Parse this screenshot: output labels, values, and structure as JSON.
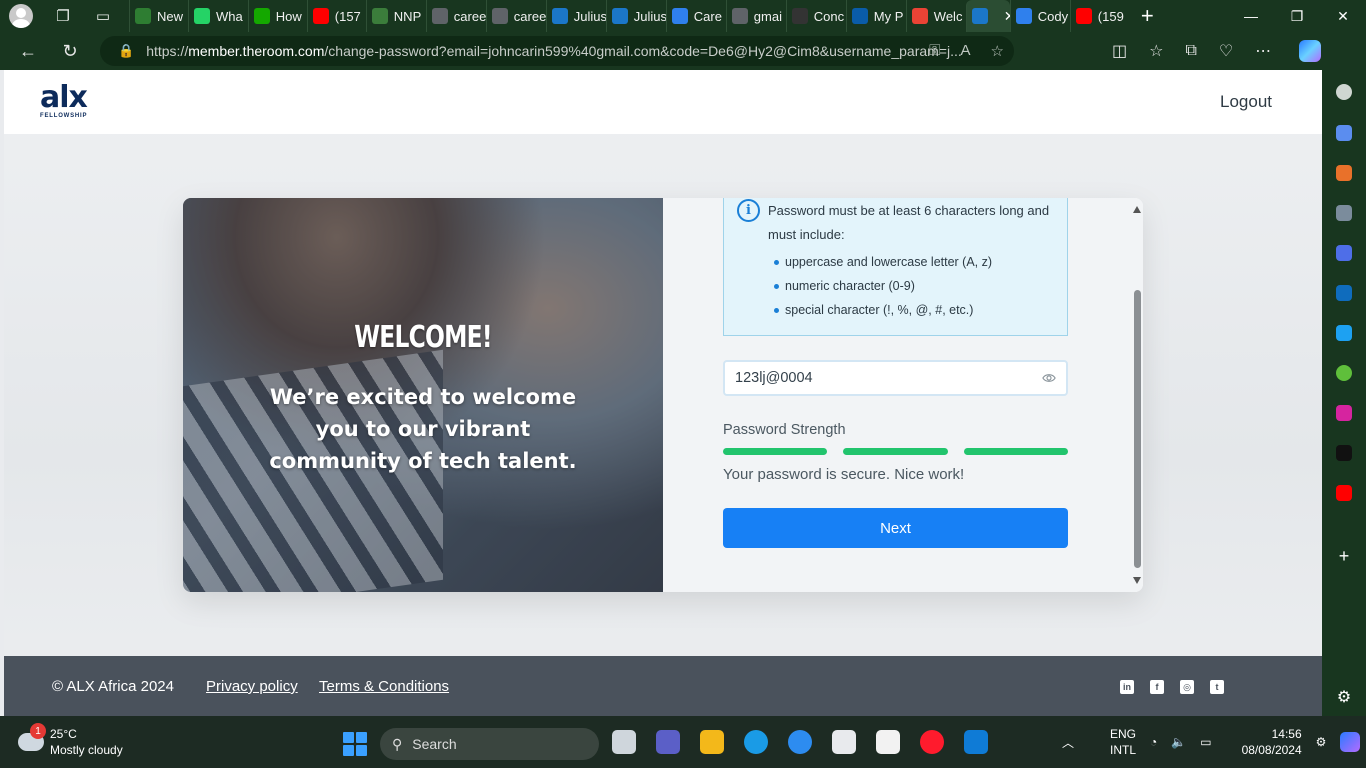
{
  "browser": {
    "tabs": [
      {
        "label": "New",
        "color": "#2e7d32"
      },
      {
        "label": "Wha",
        "color": "#25d366"
      },
      {
        "label": "How",
        "color": "#14a800"
      },
      {
        "label": "(157",
        "color": "#ff0000"
      },
      {
        "label": "NNP",
        "color": "#3b7d3b"
      },
      {
        "label": "caree",
        "color": "#5f6368"
      },
      {
        "label": "caree",
        "color": "#5f6368"
      },
      {
        "label": "Julius",
        "color": "#1b77c9"
      },
      {
        "label": "Julius",
        "color": "#1b77c9"
      },
      {
        "label": "Care",
        "color": "#2f80ed"
      },
      {
        "label": "gmai",
        "color": "#5f6368"
      },
      {
        "label": "Conc",
        "color": "#333333"
      },
      {
        "label": "My P",
        "color": "#0a5ca8"
      },
      {
        "label": "Welc",
        "color": "#ea4335"
      },
      {
        "label": "",
        "color": "#1b77c9"
      },
      {
        "label": "Cody",
        "color": "#2f80ed"
      },
      {
        "label": "(159",
        "color": "#ff0000"
      }
    ],
    "url_prefix": "https://",
    "url_domain": "member.theroom.com",
    "url_rest": "/change-password?email=johncarin599%40gmail.com&code=De6@Hy2@Cim8&username_param=j..."
  },
  "header": {
    "logo_word": "alx",
    "logo_sub": "FELLOWSHIP",
    "logout_label": "Logout"
  },
  "hero": {
    "welcome": "WELCOME!",
    "tagline": "We’re excited to welcome you to our vibrant community of tech talent."
  },
  "form": {
    "requirements_intro": "Password must be at least 6 characters long and must include:",
    "requirements": [
      "uppercase and lowercase letter (A, z)",
      "numeric character (0-9)",
      "special character (!, %, @, #, etc.)"
    ],
    "password_value": "123lj@0004",
    "strength_label": "Password Strength",
    "strength_level": 3,
    "strength_max": 3,
    "strength_color": "#22c46d",
    "strength_message": "Your password is secure. Nice work!",
    "next_label": "Next",
    "accent": "#1780f5"
  },
  "footer": {
    "copyright": "ALX Africa 2024",
    "privacy": "Privacy policy",
    "terms": "Terms & Conditions",
    "social": [
      "linkedin-icon",
      "facebook-icon",
      "instagram-icon",
      "twitter-icon"
    ]
  },
  "taskbar": {
    "weather_badge": "1",
    "temperature": "25°C",
    "condition": "Mostly cloudy",
    "search_label": "Search",
    "lang_1": "ENG",
    "lang_2": "INTL",
    "time": "14:56",
    "date": "08/08/2024"
  }
}
